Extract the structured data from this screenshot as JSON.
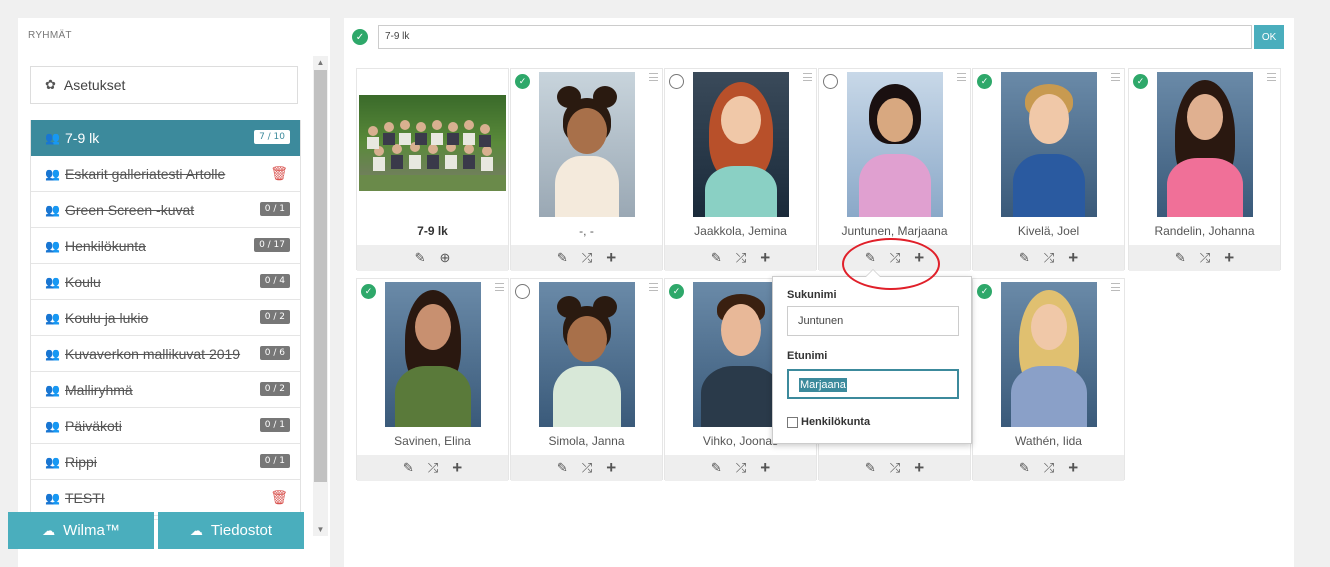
{
  "sidebar": {
    "title": "RYHMÄT",
    "settings_label": "Asetukset",
    "groups": [
      {
        "label": "7-9 lk",
        "badge": "7 / 10",
        "active": true,
        "struck": false
      },
      {
        "label": "Eskarit galleriatesti Artolle",
        "badge": "",
        "trash": true
      },
      {
        "label": "Green Screen -kuvat",
        "badge": "0 / 1"
      },
      {
        "label": "Henkilökunta",
        "badge": "0 / 17"
      },
      {
        "label": "Koulu",
        "badge": "0 / 4"
      },
      {
        "label": "Koulu ja lukio",
        "badge": "0 / 2"
      },
      {
        "label": "Kuvaverkon mallikuvat 2019",
        "badge": "0 / 6"
      },
      {
        "label": "Malliryhmä",
        "badge": "0 / 2"
      },
      {
        "label": "Päiväkoti",
        "badge": "0 / 1"
      },
      {
        "label": "Rippi",
        "badge": "0 / 1"
      },
      {
        "label": "TESTI",
        "badge": "",
        "trash": true
      }
    ],
    "buttons": {
      "wilma": "Wilma™",
      "tiedostot": "Tiedostot"
    }
  },
  "topbar": {
    "value": "7-9 lk",
    "ok_label": "OK"
  },
  "cards": [
    {
      "name": "7-9 lk",
      "status": "none",
      "kind": "group"
    },
    {
      "name": "-, -",
      "status": "checked"
    },
    {
      "name": "Jaakkola, Jemina",
      "status": "unchecked"
    },
    {
      "name": "Juntunen, Marjaana",
      "status": "unchecked"
    },
    {
      "name": "Kivelä, Joel",
      "status": "checked"
    },
    {
      "name": "Randelin, Johanna",
      "status": "checked"
    },
    {
      "name": "Savinen, Elina",
      "status": "checked"
    },
    {
      "name": "Simola, Janna",
      "status": "unchecked"
    },
    {
      "name": "Vihko, Joonas",
      "status": "checked"
    },
    {
      "name": "",
      "status": "none"
    },
    {
      "name": "Wathén, Iida",
      "status": "checked"
    }
  ],
  "popover": {
    "surname_label": "Sukunimi",
    "surname_value": "Juntunen",
    "firstname_label": "Etunimi",
    "firstname_value": "Marjaana",
    "staff_label": "Henkilökunta"
  },
  "colors": {
    "accent": "#3c8a9c",
    "button": "#4aaebd",
    "check": "#2ea86a",
    "highlight": "#e0202a"
  },
  "icons": {
    "settings": "gear-icon",
    "group": "users-icon",
    "edit": "pencil-icon",
    "zoom": "zoom-in-icon",
    "shuffle": "shuffle-icon",
    "add": "plus-icon",
    "delete": "trash-icon",
    "cloud": "cloud-upload-icon"
  }
}
